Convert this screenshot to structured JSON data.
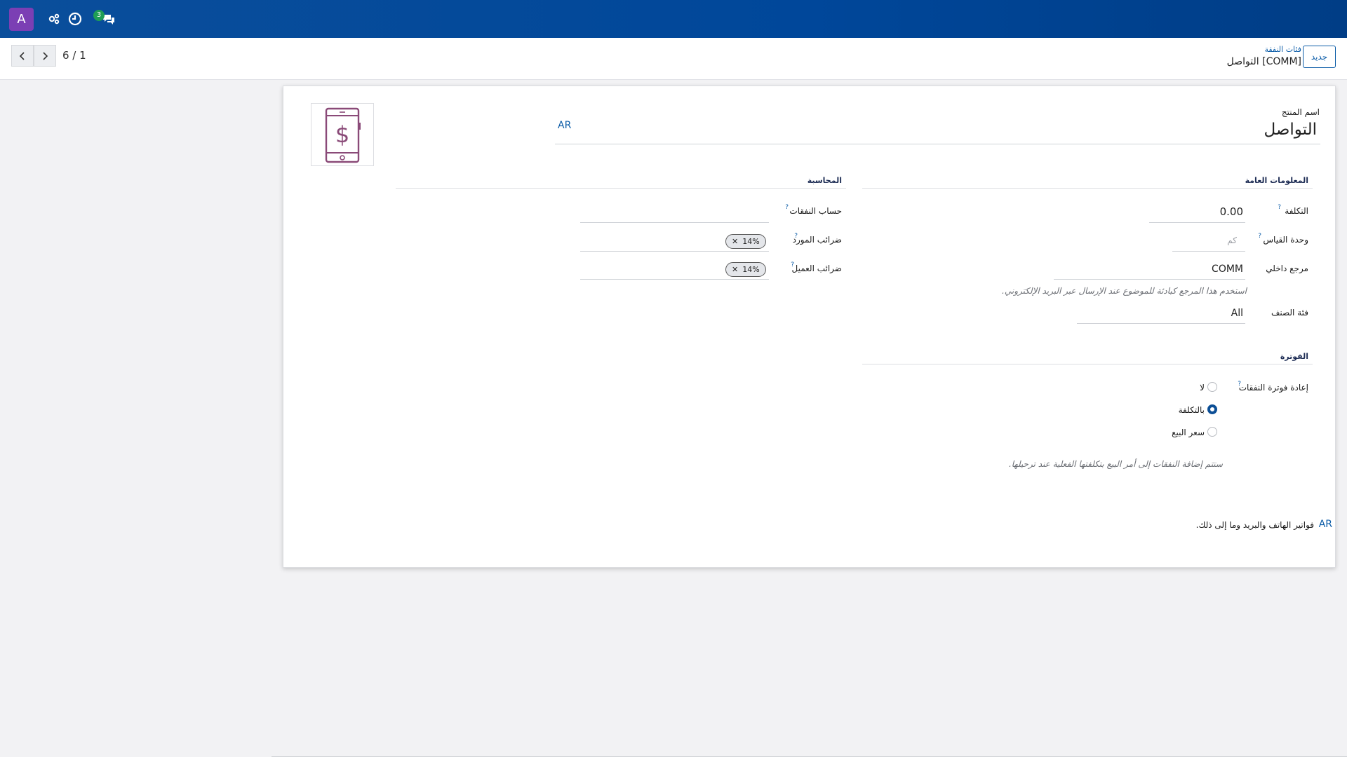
{
  "navbar": {
    "avatar_letter": "A",
    "icons": [
      "activity-icon",
      "clock-icon",
      "chat-icon"
    ],
    "chat_badge": "3"
  },
  "control": {
    "pager": "6 / 1",
    "new_button": "جديد",
    "breadcrumb_parent": "فئات النفقة",
    "breadcrumb_current": "[COMM] التواصل"
  },
  "form": {
    "name_label": "اسم المنتج",
    "name_value": "التواصل",
    "lang_tag": "AR",
    "general": {
      "title": "المعلومات العامة",
      "cost_label": "التكلفة",
      "cost_value": "0.00",
      "uom_label": "وحدة القياس",
      "uom_placeholder": "كم",
      "ref_label": "مرجع داخلي",
      "ref_value": "COMM",
      "ref_hint": "استخدم هذا المرجع كبادئة للموضوع عند الإرسال عبر البريد الإلكتروني.",
      "category_label": "فئة الصنف",
      "category_value": "All"
    },
    "accounting": {
      "title": "المحاسبة",
      "expense_account_label": "حساب النفقات",
      "vendor_taxes_label": "ضرائب المورد",
      "vendor_tax_tag": "14%",
      "customer_taxes_label": "ضرائب العميل",
      "customer_tax_tag": "14%"
    },
    "invoicing": {
      "title": "الفوترة",
      "reinvoice_label": "إعادة فوترة النفقات",
      "options": [
        "لا",
        "بالتكلفة",
        "سعر البيع"
      ],
      "selected_index": 1,
      "hint": "ستتم إضافة النفقات إلى أمر البيع بتكلفتها الفعلية عند ترحيلها."
    },
    "description": "فواتير الهاتف والبريد وما إلى ذلك.",
    "description_lang": "AR"
  },
  "colors": {
    "navbar": "#00479a",
    "accent": "#0d5da8",
    "avatar": "#7b3fb4",
    "badge": "#1f9d55"
  }
}
